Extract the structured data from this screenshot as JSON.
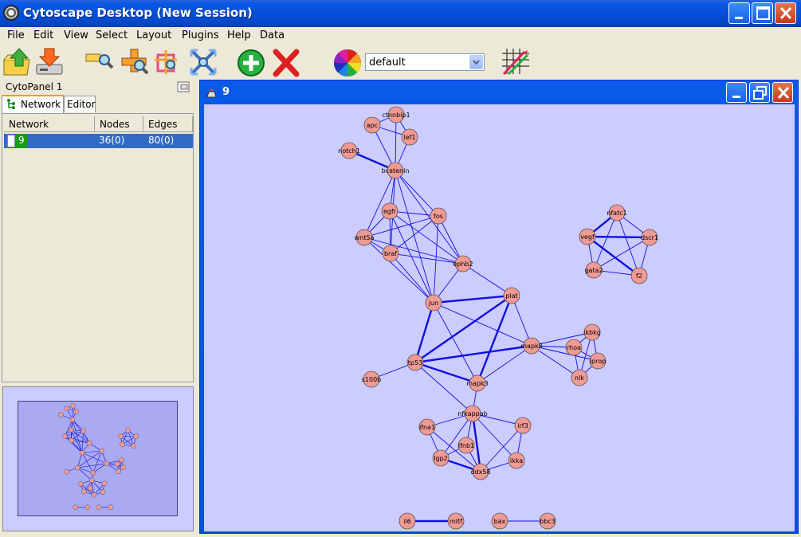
{
  "window": {
    "title": "Cytoscape Desktop (New Session)"
  },
  "menu": {
    "items": [
      "File",
      "Edit",
      "View",
      "Select",
      "Layout",
      "Plugins",
      "Help",
      "Data"
    ]
  },
  "toolbar": {
    "buttons": [
      {
        "name": "open-icon"
      },
      {
        "name": "save-icon"
      },
      {
        "name": "zoom-in-icon"
      },
      {
        "name": "zoom-out-icon"
      },
      {
        "name": "zoom-selected-icon"
      },
      {
        "name": "zoom-fit-icon"
      },
      {
        "name": "add-icon"
      },
      {
        "name": "delete-icon"
      },
      {
        "name": "vizmapper-icon"
      },
      {
        "name": "graph-icon"
      }
    ],
    "visual_style": "default"
  },
  "cytopanel": {
    "title": "CytoPanel 1",
    "tabs": [
      "Network",
      "Editor"
    ],
    "columns": [
      "Network",
      "Nodes",
      "Edges"
    ],
    "rows": [
      {
        "network": "9",
        "nodes": "36(0)",
        "edges": "80(0)"
      }
    ]
  },
  "network_frame": {
    "title": "9"
  },
  "graph": {
    "colors": {
      "node": "#f19a94",
      "edge": "#1010e0",
      "canvas": "#ccccff"
    },
    "nodes": [
      {
        "id": "ctnnbip1"
      },
      {
        "id": "apc"
      },
      {
        "id": "lef1"
      },
      {
        "id": "notch1"
      },
      {
        "id": "bcatenin"
      },
      {
        "id": "egfr"
      },
      {
        "id": "fos"
      },
      {
        "id": "wnt5a"
      },
      {
        "id": "braf"
      },
      {
        "id": "ephb2"
      },
      {
        "id": "jun"
      },
      {
        "id": "plat"
      },
      {
        "id": "mapk8"
      },
      {
        "id": "tp53"
      },
      {
        "id": "s100b"
      },
      {
        "id": "mapk3"
      },
      {
        "id": "ikbkg"
      },
      {
        "id": "rhoa"
      },
      {
        "id": "iprop"
      },
      {
        "id": "nlk"
      },
      {
        "id": "nfatc1"
      },
      {
        "id": "vegf"
      },
      {
        "id": "dscr1"
      },
      {
        "id": "gata2"
      },
      {
        "id": "f2"
      },
      {
        "id": "nfkappab"
      },
      {
        "id": "ifna1"
      },
      {
        "id": "irf3"
      },
      {
        "id": "ifnb1"
      },
      {
        "id": "lgp2"
      },
      {
        "id": "ikka"
      },
      {
        "id": "ddx58"
      },
      {
        "id": "il6"
      },
      {
        "id": "mitf"
      },
      {
        "id": "bax"
      },
      {
        "id": "bbc3"
      }
    ],
    "edges": [
      [
        "ctnnbip1",
        "apc"
      ],
      [
        "ctnnbip1",
        "lef1"
      ],
      [
        "apc",
        "lef1"
      ],
      [
        "ctnnbip1",
        "bcatenin"
      ],
      [
        "apc",
        "bcatenin"
      ],
      [
        "lef1",
        "bcatenin"
      ],
      [
        "notch1",
        "bcatenin"
      ],
      [
        "bcatenin",
        "egfr"
      ],
      [
        "bcatenin",
        "fos"
      ],
      [
        "bcatenin",
        "wnt5a"
      ],
      [
        "bcatenin",
        "braf"
      ],
      [
        "bcatenin",
        "ephb2"
      ],
      [
        "bcatenin",
        "jun"
      ],
      [
        "egfr",
        "fos"
      ],
      [
        "egfr",
        "wnt5a"
      ],
      [
        "egfr",
        "braf"
      ],
      [
        "egfr",
        "ephb2"
      ],
      [
        "egfr",
        "jun"
      ],
      [
        "fos",
        "wnt5a"
      ],
      [
        "fos",
        "braf"
      ],
      [
        "fos",
        "ephb2"
      ],
      [
        "fos",
        "jun"
      ],
      [
        "wnt5a",
        "braf"
      ],
      [
        "wnt5a",
        "ephb2"
      ],
      [
        "wnt5a",
        "jun"
      ],
      [
        "braf",
        "ephb2"
      ],
      [
        "braf",
        "jun"
      ],
      [
        "ephb2",
        "jun"
      ],
      [
        "ephb2",
        "plat"
      ],
      [
        "jun",
        "plat"
      ],
      [
        "jun",
        "mapk8"
      ],
      [
        "jun",
        "tp53"
      ],
      [
        "jun",
        "mapk3"
      ],
      [
        "plat",
        "mapk8"
      ],
      [
        "plat",
        "tp53"
      ],
      [
        "plat",
        "mapk3"
      ],
      [
        "mapk8",
        "tp53"
      ],
      [
        "mapk8",
        "mapk3"
      ],
      [
        "tp53",
        "mapk3"
      ],
      [
        "tp53",
        "s100b"
      ],
      [
        "tp53",
        "nfkappab"
      ],
      [
        "mapk3",
        "nfkappab"
      ],
      [
        "mapk8",
        "ikbkg"
      ],
      [
        "mapk8",
        "rhoa"
      ],
      [
        "mapk8",
        "iprop"
      ],
      [
        "mapk8",
        "nlk"
      ],
      [
        "ikbkg",
        "rhoa"
      ],
      [
        "ikbkg",
        "iprop"
      ],
      [
        "ikbkg",
        "nlk"
      ],
      [
        "rhoa",
        "nlk"
      ],
      [
        "iprop",
        "nlk"
      ],
      [
        "rhoa",
        "iprop"
      ],
      [
        "nfatc1",
        "vegf"
      ],
      [
        "nfatc1",
        "dscr1"
      ],
      [
        "nfatc1",
        "gata2"
      ],
      [
        "nfatc1",
        "f2"
      ],
      [
        "vegf",
        "dscr1"
      ],
      [
        "vegf",
        "gata2"
      ],
      [
        "vegf",
        "f2"
      ],
      [
        "dscr1",
        "gata2"
      ],
      [
        "dscr1",
        "f2"
      ],
      [
        "gata2",
        "f2"
      ],
      [
        "nfkappab",
        "ifna1"
      ],
      [
        "nfkappab",
        "irf3"
      ],
      [
        "nfkappab",
        "ifnb1"
      ],
      [
        "nfkappab",
        "lgp2"
      ],
      [
        "nfkappab",
        "ikka"
      ],
      [
        "nfkappab",
        "ddx58"
      ],
      [
        "ifna1",
        "lgp2"
      ],
      [
        "ifna1",
        "ddx58"
      ],
      [
        "irf3",
        "ddx58"
      ],
      [
        "irf3",
        "ikka"
      ],
      [
        "ifnb1",
        "ddx58"
      ],
      [
        "lgp2",
        "ddx58"
      ],
      [
        "ikka",
        "ddx58"
      ],
      [
        "ifnb1",
        "lgp2"
      ],
      [
        "il6",
        "mitf"
      ],
      [
        "bax",
        "bbc3"
      ]
    ]
  }
}
